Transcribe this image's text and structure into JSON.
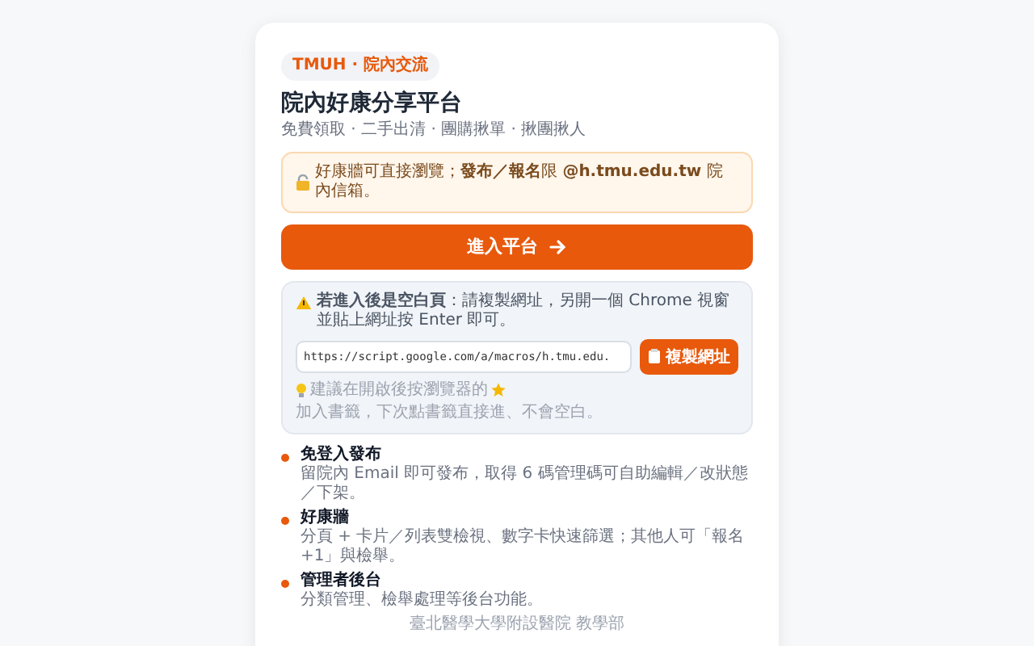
{
  "badge": "TMUH · 院內交流",
  "title": "院內好康分享平台",
  "subtitle": "免費領取 · 二手出清 · 團購揪單 · 揪團揪人",
  "notice": "好康牆可直接瀏覽；**發布／報名**限 **@h.tmu.edu.tw** 院內信箱。",
  "enter_button": "進入平台",
  "blank_page_help": {
    "text": "**若進入後是空白頁**：請複製網址，另開一個 Chrome 視窗並貼上網址按 Enter 即可。",
    "url": "https://script.google.com/a/macros/h.tmu.edu.",
    "copy_button": "複製網址",
    "tip_before": "建議在開啟後按瀏覽器的",
    "tip_after": "加入書籤，下次點書籤直接進、不會空白。"
  },
  "features": [
    {
      "title": "免登入發布",
      "description": "留院內 Email 即可發布，取得 6 碼管理碼可自助編輯／改狀態／下架。"
    },
    {
      "title": "好康牆",
      "description": "分頁 + 卡片／列表雙檢視、數字卡快速篩選；其他人可「報名 +1」與檢舉。"
    },
    {
      "title": "管理者後台",
      "description": "分類管理、檢舉處理等後台功能。"
    }
  ],
  "footer": "臺北醫學大學附設醫院 教學部"
}
